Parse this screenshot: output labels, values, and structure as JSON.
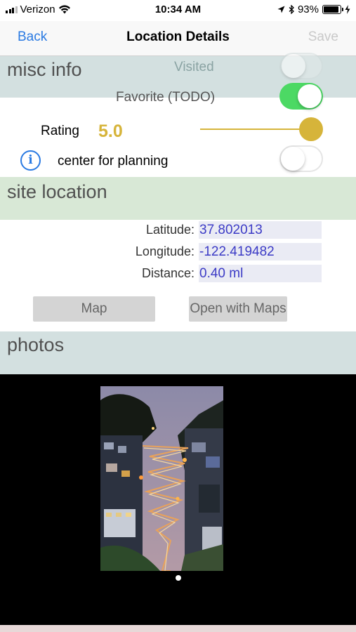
{
  "status_bar": {
    "carrier": "Verizon",
    "time": "10:34 AM",
    "battery": "93%"
  },
  "nav": {
    "back_label": "Back",
    "title": "Location Details",
    "save_label": "Save"
  },
  "misc_info": {
    "header": "misc info",
    "visited_label": "Visited",
    "visited_on": false,
    "favorite_label": "Favorite (TODO)",
    "favorite_on": true,
    "rating_label": "Rating",
    "rating_value": "5.0",
    "rating_level": 1.0,
    "center_label": "center for planning",
    "center_on": false
  },
  "site_location": {
    "header": "site location",
    "fields": [
      {
        "label": "Latitude:",
        "value": "37.802013"
      },
      {
        "label": "Longitude:",
        "value": "-122.419482"
      },
      {
        "label": "Distance:",
        "value": "0.40 ml"
      }
    ],
    "map_button": "Map",
    "open_maps_button": "Open with Maps"
  },
  "photos": {
    "header": "photos",
    "page_count": 1,
    "current_page": 1
  },
  "colors": {
    "accent_blue": "#2a7ae2",
    "toggle_green": "#4cd964",
    "rating_gold": "#d6b43a",
    "field_text": "#3c3bc6"
  }
}
